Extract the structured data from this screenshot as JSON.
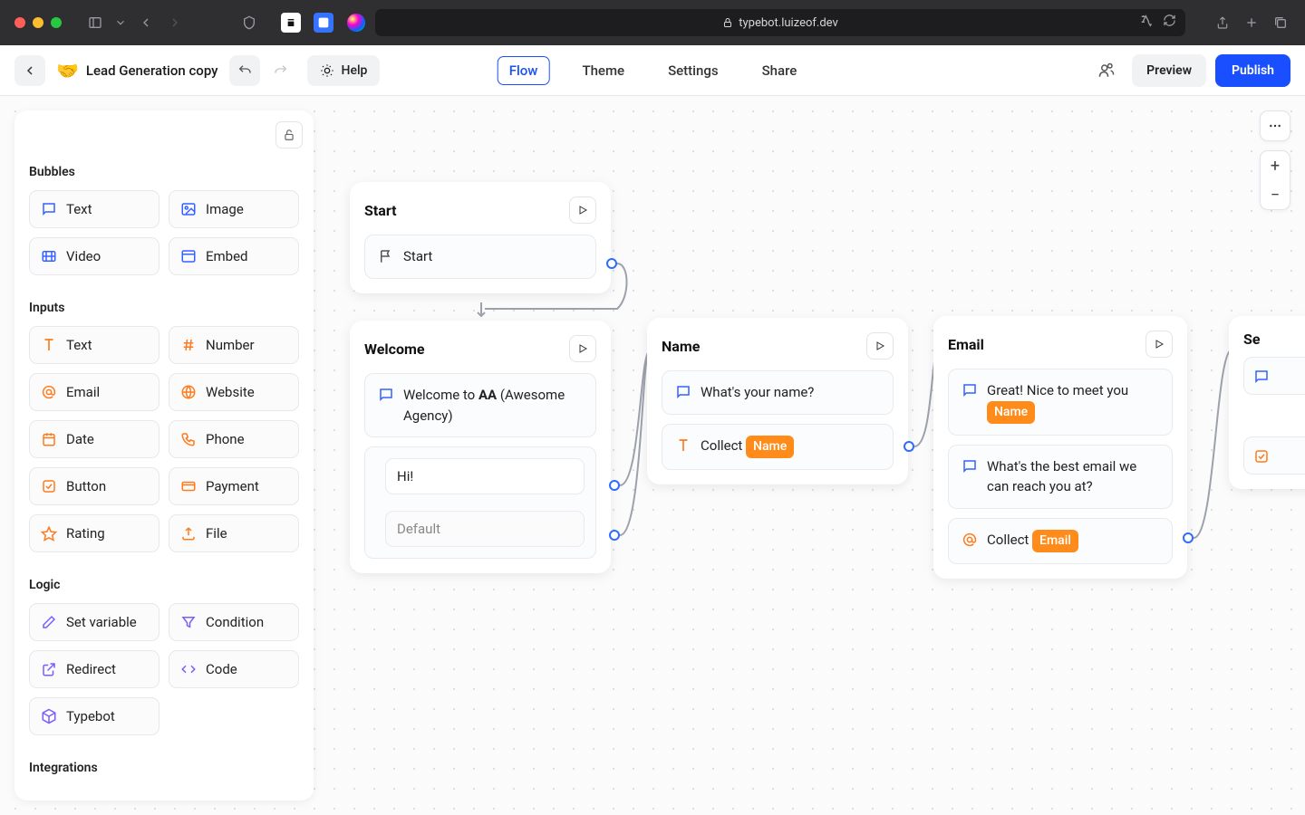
{
  "browser": {
    "url": "typebot.luizeof.dev"
  },
  "topbar": {
    "back_label": "Back",
    "bot_emoji": "🤝",
    "bot_name": "Lead Generation copy",
    "help_label": "Help",
    "nav": {
      "flow": "Flow",
      "theme": "Theme",
      "settings": "Settings",
      "share": "Share"
    },
    "preview_label": "Preview",
    "publish_label": "Publish"
  },
  "sidebar": {
    "sections": {
      "bubbles": "Bubbles",
      "inputs": "Inputs",
      "logic": "Logic",
      "integrations": "Integrations"
    },
    "bubbles": {
      "text": "Text",
      "image": "Image",
      "video": "Video",
      "embed": "Embed"
    },
    "inputs": {
      "text": "Text",
      "number": "Number",
      "email": "Email",
      "website": "Website",
      "date": "Date",
      "phone": "Phone",
      "button": "Button",
      "payment": "Payment",
      "rating": "Rating",
      "file": "File"
    },
    "logic": {
      "setvar": "Set variable",
      "condition": "Condition",
      "redirect": "Redirect",
      "code": "Code",
      "typebot": "Typebot"
    }
  },
  "cards": {
    "start": {
      "title": "Start",
      "row_label": "Start"
    },
    "welcome": {
      "title": "Welcome",
      "msg_prefix": "Welcome to ",
      "msg_bold": "AA",
      "msg_suffix": " (Awesome Agency)",
      "choice1": "Hi!",
      "choice2": "Default"
    },
    "name": {
      "title": "Name",
      "question": "What's your name?",
      "collect_label": "Collect ",
      "collect_var": "Name"
    },
    "email": {
      "title": "Email",
      "msg1_prefix": "Great! Nice to meet you ",
      "msg1_var": "Name",
      "msg2": "What's the best email we can reach you at?",
      "collect_label": "Collect ",
      "collect_var": "Email"
    },
    "partial": {
      "title": "Se"
    }
  }
}
